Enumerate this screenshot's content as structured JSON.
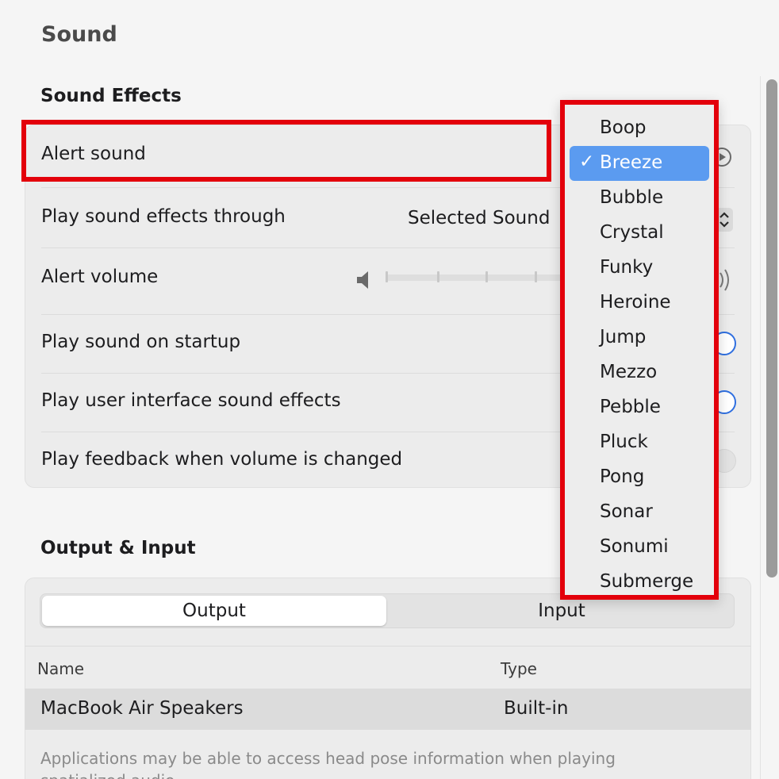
{
  "header": {
    "title": "Sound"
  },
  "sound_effects": {
    "title": "Sound Effects",
    "rows": {
      "alert_sound": {
        "label": "Alert sound"
      },
      "play_through": {
        "label": "Play sound effects through",
        "value": "Selected Sound"
      },
      "alert_volume": {
        "label": "Alert volume"
      },
      "startup": {
        "label": "Play sound on startup"
      },
      "ui_effects": {
        "label": "Play user interface sound effects"
      },
      "feedback": {
        "label": "Play feedback when volume is changed"
      }
    }
  },
  "alert_sound_menu": {
    "selected": "Breeze",
    "check_glyph": "✓",
    "items": [
      "Boop",
      "Breeze",
      "Bubble",
      "Crystal",
      "Funky",
      "Heroine",
      "Jump",
      "Mezzo",
      "Pebble",
      "Pluck",
      "Pong",
      "Sonar",
      "Sonumi",
      "Submerge"
    ]
  },
  "output_input": {
    "title": "Output & Input",
    "tabs": {
      "output": "Output",
      "input": "Input"
    },
    "table": {
      "headers": {
        "name": "Name",
        "type": "Type"
      },
      "rows": [
        {
          "name": "MacBook Air Speakers",
          "type": "Built-in"
        }
      ]
    },
    "footnote": "Applications may be able to access head pose information when playing spatialized audio."
  },
  "colors": {
    "accent": "#5b9bf0",
    "annotation": "#e3000b",
    "toggle_on": "#2f6fe0"
  },
  "icons": {
    "volume_low": "speaker-low-icon",
    "volume_high": "speaker-high-icon",
    "play": "play-circle-icon"
  }
}
